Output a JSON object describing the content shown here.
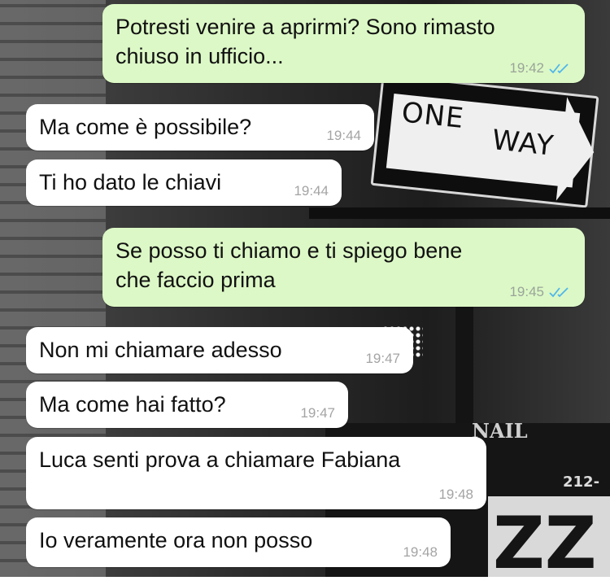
{
  "background": {
    "sign_one": "ONE",
    "sign_way": "WAY",
    "store_sign": "NAIL",
    "phone_number": "212-",
    "big_letters": "ZZ"
  },
  "messages": [
    {
      "direction": "out",
      "text": "Potresti venire a aprirmi? Sono rimasto\nchiuso in ufficio...",
      "time": "19:42",
      "read": true
    },
    {
      "direction": "in",
      "text": "Ma come è possibile?",
      "time": "19:44"
    },
    {
      "direction": "in",
      "text": "Ti ho dato le chiavi",
      "time": "19:44"
    },
    {
      "direction": "out",
      "text": "Se posso ti chiamo e ti spiego bene\nche faccio prima",
      "time": "19:45",
      "read": true
    },
    {
      "direction": "in",
      "text": "Non mi chiamare adesso",
      "time": "19:47"
    },
    {
      "direction": "in",
      "text": "Ma come hai fatto?",
      "time": "19:47"
    },
    {
      "direction": "in",
      "text": "Luca senti prova a chiamare Fabiana",
      "time": "19:48"
    },
    {
      "direction": "in",
      "text": "Io veramente ora non posso",
      "time": "19:48"
    }
  ],
  "colors": {
    "outgoing_bubble": "#dcf8c6",
    "incoming_bubble": "#ffffff",
    "read_ticks": "#4fb6ec"
  },
  "icons": {
    "read_receipt": "double-check-icon"
  }
}
